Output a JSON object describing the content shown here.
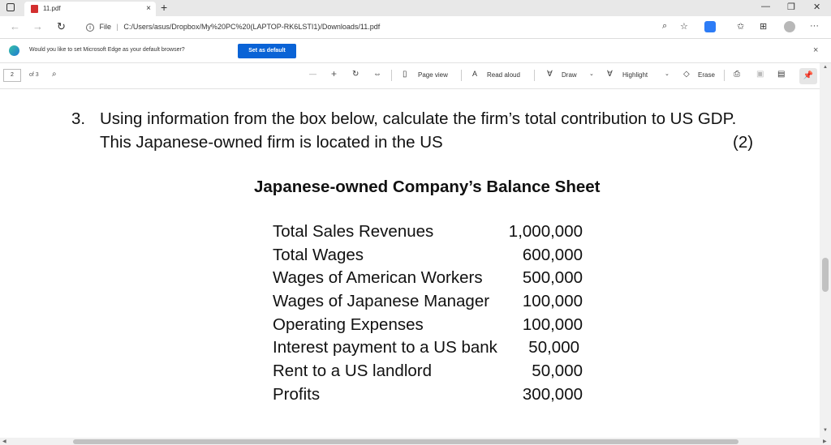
{
  "browser": {
    "tab_title": "11.pdf",
    "tab_close": "×",
    "new_tab": "+",
    "window_minimize": "—",
    "window_restore": "❐",
    "window_close": "✕",
    "address_scheme": "File",
    "address_url": "C:/Users/asus/Dropbox/My%20PC%20(LAPTOP-RK6LSTI1)/Downloads/11.pdf"
  },
  "infobar": {
    "message": "Would you like to set Microsoft Edge as your default browser?",
    "button": "Set as default",
    "close": "×"
  },
  "pdf_toolbar": {
    "page_current": "2",
    "page_total": "of 3",
    "zoom_out": "—",
    "zoom_in": "+",
    "page_view": "Page view",
    "read_aloud": "Read aloud",
    "draw": "Draw",
    "highlight": "Highlight",
    "erase": "Erase"
  },
  "document": {
    "question_number": "3.",
    "question_line1": "Using information from the box below, calculate the firm’s total contribution to US GDP.",
    "question_line2": "This Japanese-owned firm is located in the US",
    "marks": "(2)",
    "heading": "Japanese-owned Company’s Balance Sheet",
    "rows": [
      {
        "label": "Total Sales Revenues",
        "value": "1,000,000"
      },
      {
        "label": "Total Wages",
        "value": "600,000"
      },
      {
        "label": "Wages of American Workers",
        "value": "500,000"
      },
      {
        "label": "Wages of Japanese Manager",
        "value": "100,000"
      },
      {
        "label": "Operating Expenses",
        "value": "100,000"
      },
      {
        "label": "Interest payment to a US bank",
        "value": "50,000"
      },
      {
        "label": "Rent to a US landlord",
        "value": "50,000"
      },
      {
        "label": "Profits",
        "value": "300,000"
      }
    ]
  },
  "colors": {
    "accent": "#0a63d6",
    "pdf_icon": "#d32f2f"
  }
}
